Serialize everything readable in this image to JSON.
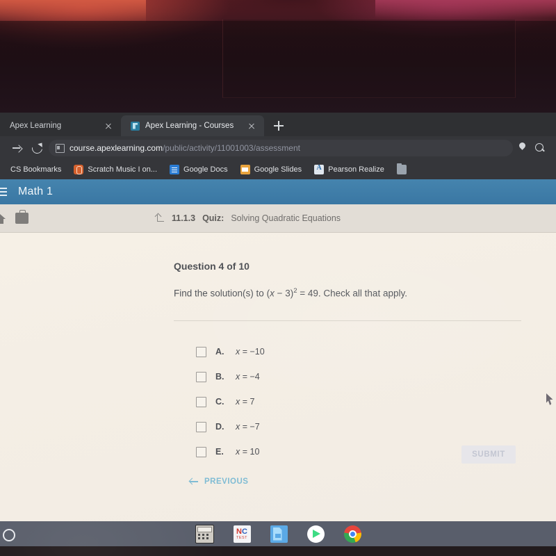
{
  "browser": {
    "tabs": [
      {
        "title": "Apex Learning",
        "active": false,
        "close_icon": "close-icon"
      },
      {
        "title": "Apex Learning - Courses",
        "active": true,
        "close_icon": "close-icon"
      }
    ],
    "new_tab_label": "+",
    "omnibox": {
      "host": "course.apexlearning.com",
      "path": "/public/activity/11001003/assessment"
    },
    "toolbar_icons": [
      "forward-icon",
      "reload-icon",
      "page-info-icon",
      "location-pin-icon",
      "search-icon"
    ],
    "bookmarks": [
      {
        "label": "CS Bookmarks",
        "icon": "none"
      },
      {
        "label": "Scratch Music I on...",
        "icon": "scratch-icon"
      },
      {
        "label": "Google Docs",
        "icon": "google-docs-icon"
      },
      {
        "label": "Google Slides",
        "icon": "google-slides-icon"
      },
      {
        "label": "Pearson Realize",
        "icon": "pearson-realize-icon"
      },
      {
        "label": "",
        "icon": "folder-icon"
      }
    ]
  },
  "app": {
    "course_title": "Math 1",
    "menu_icon": "hamburger-icon",
    "sub_header_icons": [
      "home-icon",
      "briefcase-icon"
    ],
    "breadcrumb": {
      "up_icon": "up-level-icon",
      "number": "11.1.3",
      "kind": "Quiz:",
      "name": "Solving Quadratic Equations"
    }
  },
  "question": {
    "counter": "Question 4 of 10",
    "prompt_prefix": "Find the solution(s) to (",
    "prompt_var": "x",
    "prompt_mid": " − 3)",
    "prompt_exp": "2",
    "prompt_suffix": " = 49. Check all that apply.",
    "choices": [
      {
        "letter": "A.",
        "var": "x",
        "value": " = −10",
        "checked": false
      },
      {
        "letter": "B.",
        "var": "x",
        "value": " = −4",
        "checked": false
      },
      {
        "letter": "C.",
        "var": "x",
        "value": " = 7",
        "checked": false
      },
      {
        "letter": "D.",
        "var": "x",
        "value": " = −7",
        "checked": false
      },
      {
        "letter": "E.",
        "var": "x",
        "value": " = 10",
        "checked": false
      }
    ]
  },
  "actions": {
    "submit_label": "SUBMIT",
    "submit_enabled": false,
    "previous_label": "PREVIOUS",
    "previous_icon": "arrow-left-icon"
  },
  "shelf": {
    "launcher_icon": "launcher-circle-icon",
    "apps": [
      {
        "name": "calculator-icon"
      },
      {
        "name": "nc-test-icon",
        "text_n": "N",
        "text_c": "C",
        "text_sub": "TEST"
      },
      {
        "name": "google-docs-app-icon"
      },
      {
        "name": "play-store-icon"
      },
      {
        "name": "chrome-icon"
      }
    ]
  },
  "colors": {
    "app_header": "#3a77a3",
    "page_background": "#f3ece2",
    "link_blue": "#7fbcd4",
    "text_primary": "#4e5055",
    "shelf": "#595e6b"
  }
}
